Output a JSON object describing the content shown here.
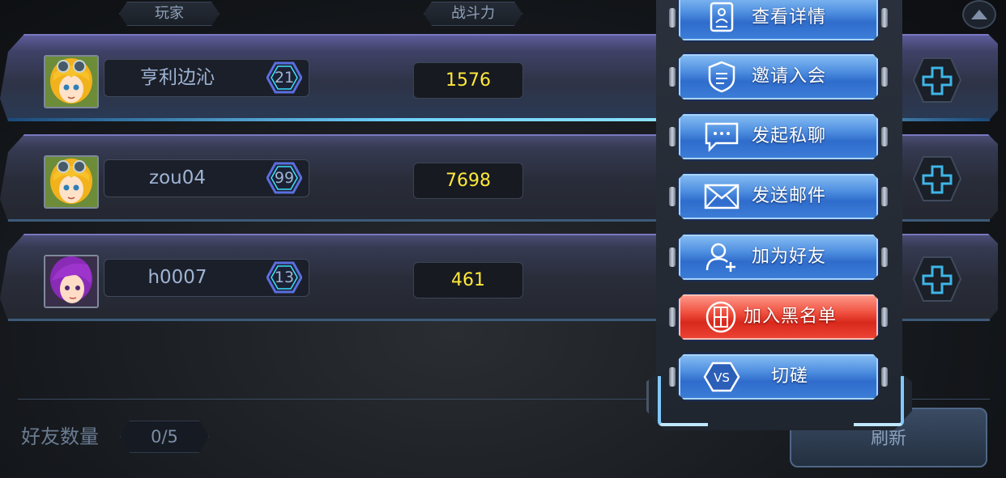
{
  "header": {
    "player": "玩家",
    "power": "战斗力"
  },
  "rows": [
    {
      "name": "亨利边沁",
      "level": "21",
      "power": "1576",
      "avatar": "blonde-goggles-girl",
      "selected": true
    },
    {
      "name": "zou04",
      "level": "99",
      "power": "7698",
      "avatar": "blonde-goggles-girl",
      "selected": false
    },
    {
      "name": "h0007",
      "level": "13",
      "power": "461",
      "avatar": "purple-hair-girl",
      "selected": false
    }
  ],
  "footer": {
    "friends_label": "好友数量",
    "friends_count": "0/5",
    "refresh_label": "刷新"
  },
  "menu": {
    "items": [
      {
        "label": "查看详情",
        "icon": "profile-card-icon",
        "style": "blue"
      },
      {
        "label": "邀请入会",
        "icon": "shield-doc-icon",
        "style": "blue"
      },
      {
        "label": "发起私聊",
        "icon": "chat-bubble-icon",
        "style": "blue"
      },
      {
        "label": "发送邮件",
        "icon": "envelope-icon",
        "style": "blue"
      },
      {
        "label": "加为好友",
        "icon": "add-user-icon",
        "style": "blue"
      },
      {
        "label": "加入黑名单",
        "icon": "blacklist-icon",
        "style": "red"
      },
      {
        "label": "切磋",
        "icon": "vs-icon",
        "style": "blue"
      }
    ]
  },
  "colors": {
    "power_text": "#ffe83a",
    "menu_blue": "#3d7fd8",
    "menu_red": "#ee4636",
    "accent_cyan": "#6fd3ff"
  }
}
